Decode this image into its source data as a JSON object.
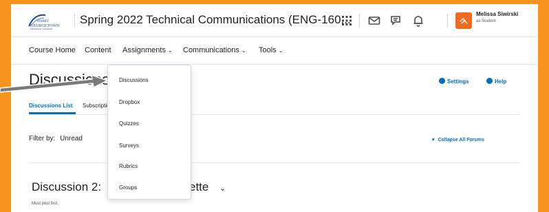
{
  "brand": {
    "logo_top": "HORRY",
    "logo_main": "GEORGETOWN",
    "logo_sub": "TECHNICAL COLLEGE",
    "background_color": "#f7941d",
    "accent_color": "#006fbf"
  },
  "header": {
    "course_title": "Spring 2022 Technical Communications (ENG-160...",
    "icons": [
      "apps-grid-icon",
      "mail-icon",
      "chat-icon",
      "bell-icon"
    ],
    "user_name": "Melissa Siwirski",
    "user_role": "as Student"
  },
  "nav": {
    "items": [
      {
        "label": "Course Home"
      },
      {
        "label": "Content"
      },
      {
        "label": "Assignments"
      },
      {
        "label": "Communications"
      },
      {
        "label": "Tools"
      }
    ]
  },
  "page": {
    "title": "Discussions",
    "settings_label": "Settings",
    "help_label": "Help",
    "tabs": [
      {
        "label": "Discussions List"
      },
      {
        "label": "Subscriptions"
      }
    ],
    "filter_prefix": "Filter by:",
    "filter_value": "Unread",
    "collapse_label": "Collapse All Forums",
    "topic_title": "Discussion 2:",
    "topic_suffix": "ette",
    "topic_subtitle": "Must post first."
  },
  "assignments_menu": {
    "items": [
      {
        "label": "Discussions"
      },
      {
        "label": "Dropbox"
      },
      {
        "label": "Quizzes"
      },
      {
        "label": "Surveys"
      },
      {
        "label": "Rubrics"
      },
      {
        "label": "Groups"
      }
    ]
  }
}
